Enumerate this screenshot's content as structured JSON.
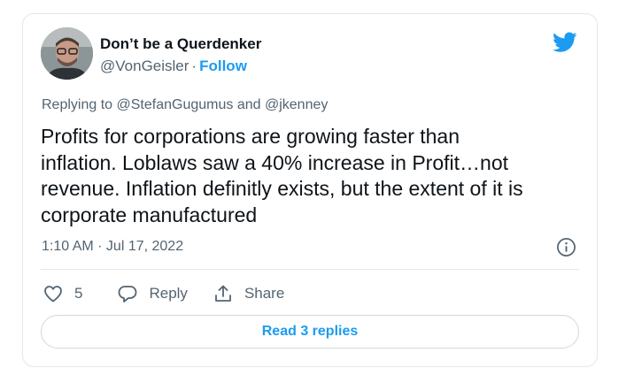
{
  "tweet": {
    "author": {
      "display_name": "Don’t be a Querdenker",
      "handle": "@VonGeisler",
      "separator": "·",
      "follow_label": "Follow",
      "avatar_icon": "avatar-photo"
    },
    "brand_icon": "twitter-bird-icon",
    "brand_color": "#1d9bf0",
    "replying": {
      "prefix": "Replying to",
      "mention_1": "@StefanGugumus",
      "conjunction": "and",
      "mention_2": "@jkenney"
    },
    "text": "Profits for corporations are growing faster than\ninflation. Loblaws saw a 40% increase in Profit…not\nrevenue. Inflation definitly exists, but  the extent of it is\ncorporate manufactured",
    "timestamp": "1:10 AM · Jul 17, 2022",
    "info_icon": "info-icon",
    "actions": {
      "like_count": "5",
      "reply_label": "Reply",
      "share_label": "Share"
    },
    "read_replies_label": "Read 3 replies"
  }
}
